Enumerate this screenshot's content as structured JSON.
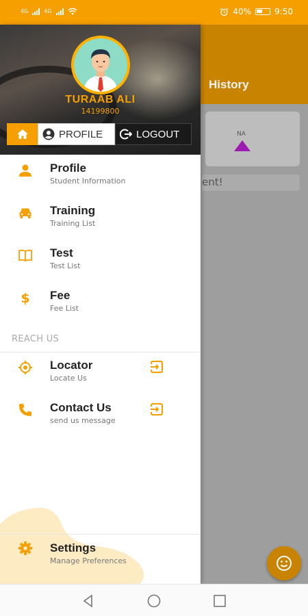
{
  "status_bar": {
    "battery_percent": "40%",
    "time": "9:50",
    "network_labels": [
      "4G",
      "4G"
    ]
  },
  "background_app": {
    "tab_label": "History",
    "card_label": "NA",
    "message_fragment": "ent!"
  },
  "drawer": {
    "user": {
      "name": "TURAAB ALI",
      "id": "14199800"
    },
    "header_buttons": {
      "profile_label": "PROFILE",
      "logout_label": "LOGOUT"
    },
    "items": [
      {
        "title": "Profile",
        "subtitle": "Student Information",
        "icon": "person-icon"
      },
      {
        "title": "Training",
        "subtitle": "Training List",
        "icon": "car-icon"
      },
      {
        "title": "Test",
        "subtitle": "Test List",
        "icon": "book-icon"
      },
      {
        "title": "Fee",
        "subtitle": "Fee List",
        "icon": "dollar-icon"
      }
    ],
    "reach_us": {
      "section_label": "REACH US",
      "items": [
        {
          "title": "Locator",
          "subtitle": "Locate Us",
          "icon": "locator-icon"
        },
        {
          "title": "Contact Us",
          "subtitle": "send us message",
          "icon": "phone-icon"
        }
      ]
    },
    "settings": {
      "title": "Settings",
      "subtitle": "Manage Preferences",
      "icon": "gear-icon"
    }
  },
  "colors": {
    "accent": "#F5A000",
    "dark_accent": "#C88400",
    "purple": "#9C1BB0"
  }
}
